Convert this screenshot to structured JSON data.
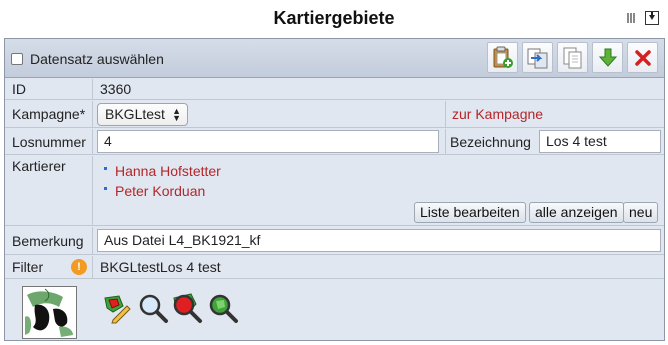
{
  "title": "Kartiergebiete",
  "toolbar": {
    "select_all_label": "Datensatz auswählen",
    "buttons": [
      {
        "name": "paste-add-icon"
      },
      {
        "name": "copy-dataset-icon"
      },
      {
        "name": "duplicate-icon"
      },
      {
        "name": "download-icon"
      },
      {
        "name": "delete-icon"
      }
    ]
  },
  "fields": {
    "id": {
      "label": "ID",
      "value": "3360"
    },
    "kampagne": {
      "label": "Kampagne*",
      "value": "BKGLtest",
      "link": "zur Kampagne"
    },
    "losnummer": {
      "label": "Losnummer",
      "value": "4"
    },
    "bezeichnung": {
      "label": "Bezeichnung",
      "value": "Los 4 test"
    },
    "kartierer": {
      "label": "Kartierer",
      "items": [
        "Hanna Hofstetter",
        "Peter Korduan"
      ],
      "buttons": {
        "edit": "Liste bearbeiten",
        "show_all": "alle anzeigen",
        "new": "neu"
      }
    },
    "bemerkung": {
      "label": "Bemerkung",
      "value": "Aus Datei L4_BK1921_kf"
    },
    "filter": {
      "label": "Filter",
      "value": "BKGLtestLos 4 test",
      "warn_symbol": "!"
    }
  },
  "colors": {
    "link": "#b3262a",
    "panel": "#e1e7f0",
    "warning": "#f39a22"
  }
}
